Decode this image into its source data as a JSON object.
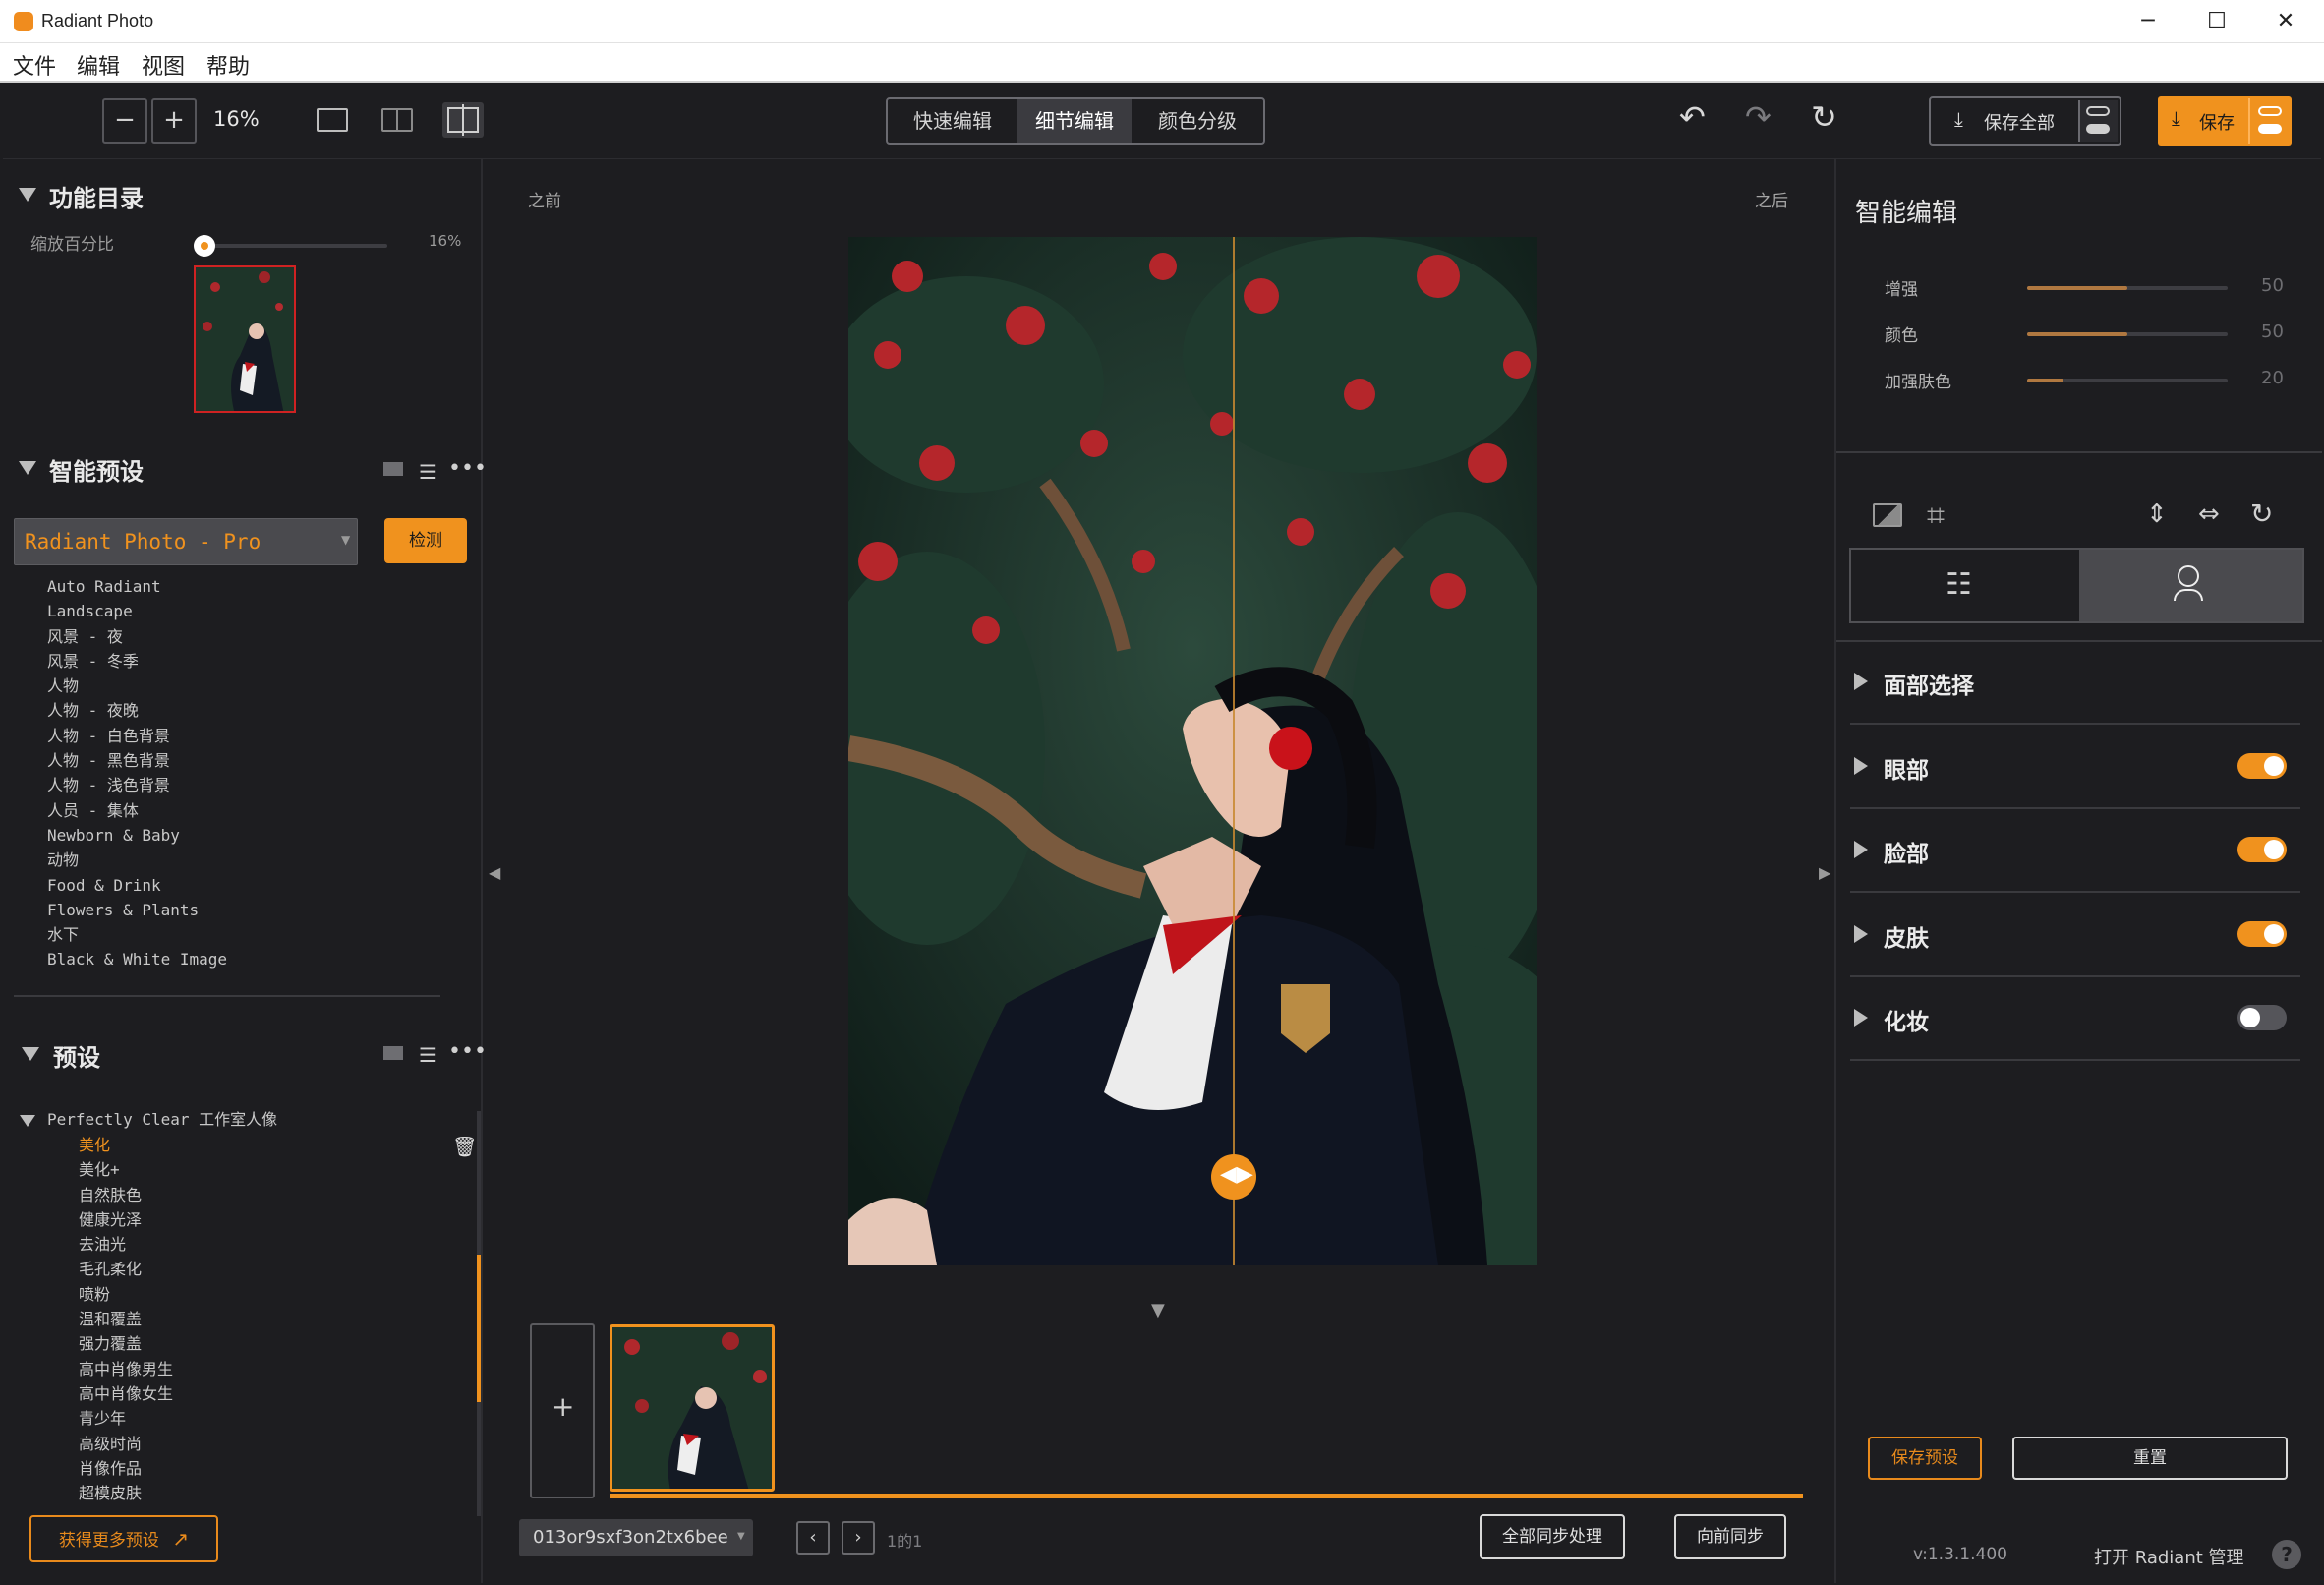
{
  "window": {
    "title": "Radiant Photo",
    "controls": {
      "minimize": "─",
      "maximize": "☐",
      "close": "✕"
    }
  },
  "menu": [
    "文件",
    "编辑",
    "视图",
    "帮助"
  ],
  "toolbar": {
    "zoom_out": "−",
    "zoom_in": "+",
    "zoom_value": "16%",
    "modes": [
      "快速编辑",
      "细节编辑",
      "颜色分级"
    ],
    "active_mode": "细节编辑",
    "save_all": "保存全部",
    "save": "保存"
  },
  "left": {
    "catalog_title": "功能目录",
    "zoom_label": "缩放百分比",
    "zoom_value": "16%",
    "zoom_fraction": 0.05,
    "smart_presets_title": "智能预设",
    "preset_select": "Radiant Photo - Pro",
    "detect": "检测",
    "smart_presets": [
      "Auto Radiant",
      "Landscape",
      "风景 - 夜",
      "风景 - 冬季",
      "人物",
      "人物 - 夜晚",
      "人物 - 白色背景",
      "人物 - 黑色背景",
      "人物 - 浅色背景",
      "人员 - 集体",
      "Newborn & Baby",
      "动物",
      "Food & Drink",
      "Flowers & Plants",
      "水下",
      "Black & White Image"
    ],
    "presets_title": "预设",
    "preset_group": "Perfectly Clear 工作室人像",
    "presets": [
      "美化",
      "美化+",
      "自然肤色",
      "健康光泽",
      "去油光",
      "毛孔柔化",
      "喷粉",
      "温和覆盖",
      "强力覆盖",
      "高中肖像男生",
      "高中肖像女生",
      "青少年",
      "高级时尚",
      "肖像作品",
      "超模皮肤"
    ],
    "selected_preset": "美化",
    "get_more": "获得更多预设"
  },
  "canvas": {
    "before_label": "之前",
    "after_label": "之后",
    "add_image": "+",
    "file_name": "013or9sxf3on2tx6bee",
    "page_info": "1的1",
    "sync_all": "全部同步处理",
    "sync_forward": "向前同步"
  },
  "right": {
    "title": "智能编辑",
    "sliders": [
      {
        "label": "增强",
        "value": "50",
        "fraction": 0.5
      },
      {
        "label": "颜色",
        "value": "50",
        "fraction": 0.5
      },
      {
        "label": "加强肤色",
        "value": "20",
        "fraction": 0.18
      }
    ],
    "face_sections": [
      {
        "label": "面部选择",
        "toggle": null
      },
      {
        "label": "眼部",
        "toggle": true
      },
      {
        "label": "脸部",
        "toggle": true
      },
      {
        "label": "皮肤",
        "toggle": true
      },
      {
        "label": "化妆",
        "toggle": false
      }
    ],
    "save_preset": "保存预设",
    "reset": "重置",
    "version": "v:1.3.1.400",
    "open_manager": "打开 Radiant 管理",
    "help": "?"
  },
  "colors": {
    "accent": "#f0921e",
    "panel_bg": "#1d1d20",
    "titlebar_bg": "#ffffff"
  }
}
